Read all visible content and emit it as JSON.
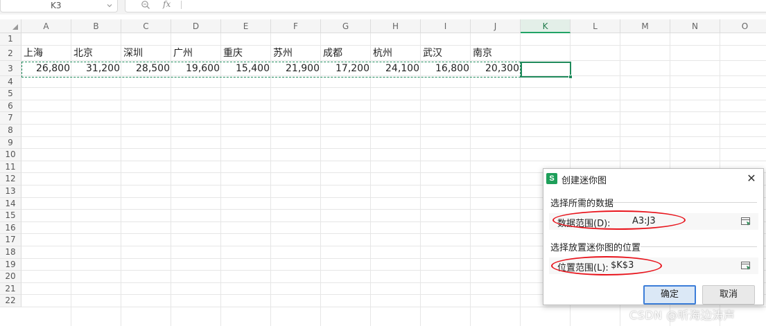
{
  "name_box": {
    "value": "K3"
  },
  "formula_bar": {
    "fx_label": "fx",
    "value": ""
  },
  "columns": [
    "A",
    "B",
    "C",
    "D",
    "E",
    "F",
    "G",
    "H",
    "I",
    "J",
    "K",
    "L",
    "M",
    "N",
    "O"
  ],
  "rows": [
    "1",
    "2",
    "3",
    "4",
    "5",
    "6",
    "7",
    "8",
    "9",
    "10",
    "11",
    "12",
    "13",
    "14",
    "15",
    "16",
    "17",
    "18",
    "19",
    "20",
    "21",
    "22"
  ],
  "active_column": "K",
  "sheet": {
    "row2": [
      "上海",
      "北京",
      "深圳",
      "广州",
      "重庆",
      "苏州",
      "成都",
      "杭州",
      "武汉",
      "南京"
    ],
    "row3": [
      "26,800",
      "31,200",
      "28,500",
      "19,600",
      "15,400",
      "21,900",
      "17,200",
      "24,100",
      "16,800",
      "20,300"
    ]
  },
  "dialog": {
    "app_icon": "S",
    "title": "创建迷你图",
    "close_icon": "✕",
    "data_section": "选择所需的数据",
    "data_range_label": "数据范围(D):",
    "data_range_value": "A3:J3",
    "location_section": "选择放置迷你图的位置",
    "location_range_label": "位置范围(L):",
    "location_range_value": "$K$3",
    "ok_label": "确定",
    "cancel_label": "取消"
  },
  "watermark": "CSDN @听海边涛声",
  "colors": {
    "accent_green": "#1f8a5b",
    "annotation_red": "#e8141c",
    "ok_border": "#3b7dd8"
  }
}
